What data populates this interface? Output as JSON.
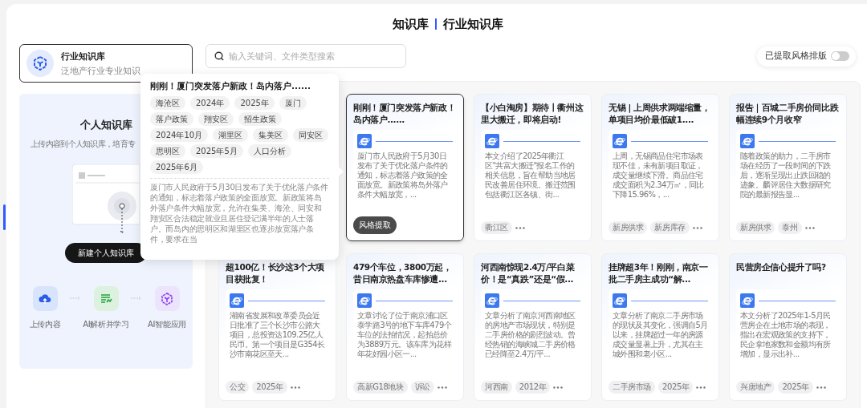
{
  "header": {
    "title": "知识库",
    "subtitle": "行业知识库"
  },
  "category_card": {
    "title": "行业知识库",
    "description": "泛地产行业专业知识"
  },
  "personal_kb": {
    "title": "个人知识库",
    "description": "上传内容到个人知识库，培育专",
    "button": "新建个人知识库",
    "steps": [
      {
        "kind": "upload",
        "label": "上传内容"
      },
      {
        "kind": "learn",
        "label": "AI解析并学习"
      },
      {
        "kind": "apply",
        "label": "AI智能应用"
      }
    ]
  },
  "search": {
    "placeholder": "输入关键词、文件类型搜索"
  },
  "toggle": {
    "label": "已提取风格排版",
    "on": false
  },
  "popover": {
    "title": "刚刚！厦门突发落户新政！岛内落户......",
    "tags": [
      "海沧区",
      "2024年",
      "2025年",
      "厦门",
      "落户政策",
      "翔安区",
      "招生政策",
      "2024年10月",
      "湖里区",
      "集美区",
      "同安区",
      "思明区",
      "2025年5月",
      "人口分析",
      "2025年6月"
    ],
    "summary": "厦门市人民政府于5月30日发布了关于优化落户条件的通知，标志着落户政策的全面放宽。新政策将岛外落户条件大幅放宽，允许在集美、海沧、同安和翔安区合法稳定就业且居住登记满半年的人士落户。而岛内的思明区和湖里区也逐步放宽落户条件，要求在当"
  },
  "cards": [
    {
      "title": "刚刚！厦门突发落户新政！岛内落户......",
      "summary": "厦门市人民政府于5月30日发布了关于优化落户条件的通知，标志着落户政策的全面放宽。新政策将岛外落户条件大幅放宽，...",
      "selected": true,
      "button": "风格提取"
    },
    {
      "title": "【小白淘房】期待丨衢州这里大搬迁，即将启动!",
      "summary": "本文介绍了2025年衢江区\"共富大搬迁\"报名工作的相关信息，旨在帮助当地居民改善居住环境。搬迁范围包括衢江区各镇、街...",
      "selected": false,
      "tags": [
        "衢江区"
      ]
    },
    {
      "title": "无锡 | 上周供求两端缩量，单项目均价最低破1....",
      "summary": "上周，无锡商品住宅市场表现不佳，未有新项目取证，成交量继续下滑。商品住宅成交面积为2.34万㎡，同比下降15.96%，...",
      "selected": false,
      "tags": [
        "新房供求",
        "新房库存"
      ]
    },
    {
      "title": "报告｜百城二手房价同比跌幅连续9个月收窄",
      "summary": "随着政策的助力，二手房市场在经历了一段时间的下跌后，逐渐呈现出止跌回稳的迹象。麟评居住大数据研究院的最新报告显...",
      "selected": false,
      "tags": [
        "新房供求",
        "泰州"
      ]
    },
    {
      "title": "超100亿！长沙这3个大项目获批复！",
      "summary": "湖南省发展和改革委员会近日批准了三个长沙市公路大项目，总投资达109.25亿人民币。第一个项目是G354长沙市南花区至天...",
      "selected": false,
      "tags": [
        "公交",
        "2025年"
      ]
    },
    {
      "title": "479个车位，3800万起，昔日南京热盘车库惨遭...",
      "summary": "文章讨论了位于南京浦口区泰学路3号的地下车库479个车位的法拍情况，起拍总价为3889万元。该车库为花样年花好园小区一...",
      "selected": false,
      "tags": [
        "高新G18地块",
        "诉讼"
      ]
    },
    {
      "title": "河西南惊现2.4万/平白菜价！是“真跌”还是“假...",
      "summary": "文章分析了南京河西南地区的房地产市场现状，特别是二手房价格的剧烈波动。曾经热销的海峡城二手房价格已经降至2.4万/平...",
      "selected": false,
      "tags": [
        "河西南",
        "2012年"
      ]
    },
    {
      "title": "挂牌超3年！刚刚，南京一批二手房主成功“解...",
      "summary": "文章分析了南京二手房市场的现状及其变化，强调自5月以来，挂牌超过一年的房源成交量显著上升，尤其在主城外围和老小区...",
      "selected": false,
      "tags": [
        "二手房市场",
        "2025年"
      ]
    },
    {
      "title": "民营房企信心提升了吗?",
      "summary": "本文分析了2025年1-5月民营房企在土地市场的表现，指出在宏观政策的支持下，民企拿地家数和金额均有所增加，显示出补...",
      "selected": false,
      "tags": [
        "兴唐地产",
        "2025年"
      ]
    }
  ]
}
